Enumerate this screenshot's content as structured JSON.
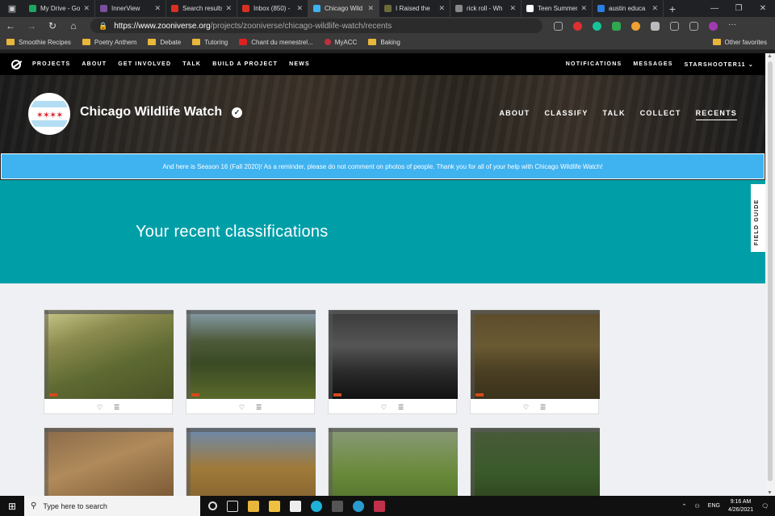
{
  "browser": {
    "tabs": [
      {
        "label": "My Drive - Go",
        "color": "#1fa463",
        "active": false
      },
      {
        "label": "InnerView",
        "color": "#7b4ea0",
        "active": false
      },
      {
        "label": "Search results",
        "color": "#d93025",
        "active": false
      },
      {
        "label": "Inbox (850) -",
        "color": "#d93025",
        "active": false
      },
      {
        "label": "Chicago Wild",
        "color": "#3fb2f0",
        "active": true
      },
      {
        "label": "I Raised the",
        "color": "#6b6b3a",
        "active": false
      },
      {
        "label": "rick roll - Wh",
        "color": "#888888",
        "active": false
      },
      {
        "label": "Teen Summer",
        "color": "#ffffff",
        "active": false
      },
      {
        "label": "austin educa",
        "color": "#2a7de1",
        "active": false
      }
    ],
    "url_host": "https://www.zooniverse.org",
    "url_path": "/projects/zooniverse/chicago-wildlife-watch/recents",
    "bookmarks": [
      {
        "label": "Smoothie Recipes",
        "kind": "folder"
      },
      {
        "label": "Poetry Anthem",
        "kind": "folder"
      },
      {
        "label": "Debate",
        "kind": "folder"
      },
      {
        "label": "Tutoring",
        "kind": "folder"
      },
      {
        "label": "Chant du menestrel...",
        "kind": "youtube"
      },
      {
        "label": "MyACC",
        "kind": "site"
      },
      {
        "label": "Baking",
        "kind": "folder"
      }
    ],
    "other_favorites": "Other favorites"
  },
  "zooniverse": {
    "nav": [
      "PROJECTS",
      "ABOUT",
      "GET INVOLVED",
      "TALK",
      "BUILD A PROJECT",
      "NEWS"
    ],
    "right": {
      "notifications": "NOTIFICATIONS",
      "messages": "MESSAGES",
      "user": "STARSHOOTER11"
    }
  },
  "project": {
    "title": "Chicago Wildlife Watch",
    "nav": [
      "ABOUT",
      "CLASSIFY",
      "TALK",
      "COLLECT",
      "RECENTS"
    ],
    "current_nav": "RECENTS",
    "banner": "And here is Season 16 (Fall 2020)! As a reminder, please do not comment on photos of people. Thank you for all of your help with Chicago Wildlife Watch!",
    "heading": "Your recent classifications",
    "field_guide": "FIELD GUIDE"
  },
  "recents": [
    {
      "scene": "sunlit-forest-floor",
      "bg": "linear-gradient(160deg,#c9c98a 0%,#8b8a4e 30%,#5e6a32 60%,#4a5226 100%)"
    },
    {
      "scene": "park-with-trees",
      "bg": "linear-gradient(180deg,#8aa0b0 0%,#4e5a3a 35%,#3a4a24 60%,#5a6a2a 100%)"
    },
    {
      "scene": "night-infrared",
      "bg": "linear-gradient(180deg,#3a3a3a 0%,#555 40%,#2a2a2a 70%,#111 100%)"
    },
    {
      "scene": "leaf-litter-woods",
      "bg": "linear-gradient(180deg,#5a4a2a 0%,#6a5a32 40%,#4a3e22 70%,#3a321c 100%)"
    },
    {
      "scene": "deer-foraging",
      "bg": "linear-gradient(160deg,#8a6a4a 0%,#b08a5a 40%,#6a4a2a 100%)"
    },
    {
      "scene": "autumn-trees-sky",
      "bg": "linear-gradient(180deg,#6a8ab0 0%,#a07a3a 45%,#7a5a2a 100%)"
    },
    {
      "scene": "grass-clearing",
      "bg": "linear-gradient(180deg,#8a9a7a 0%,#6a8a3a 50%,#4a6a2a 100%)"
    },
    {
      "scene": "lawn-edge",
      "bg": "linear-gradient(180deg,#4a5a3a 0%,#3a5a2a 50%,#2a3a1a 100%)"
    }
  ],
  "taskbar": {
    "search_placeholder": "Type here to search",
    "lang": "ENG",
    "time": "9:16 AM",
    "date": "4/26/2021"
  }
}
